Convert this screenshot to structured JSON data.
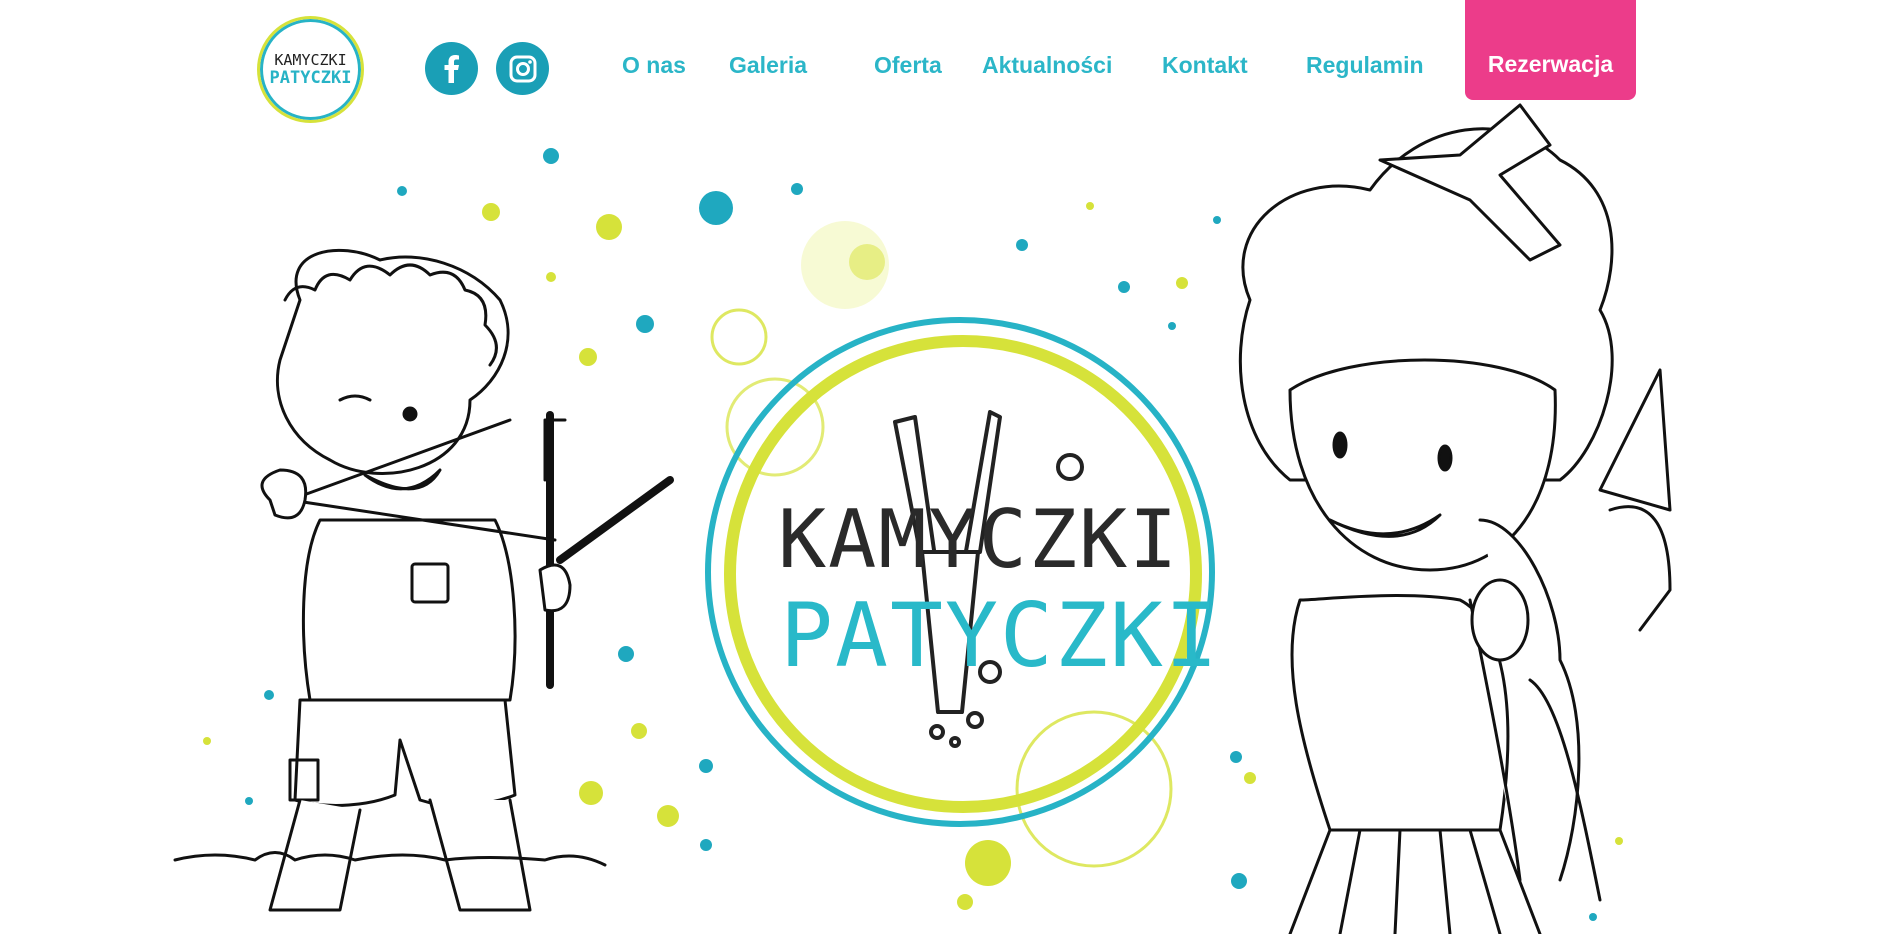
{
  "brand": {
    "logo_line1": "KAMYCZKI",
    "logo_line2": "PATYCZKI",
    "hero_line1": "KAMYCZKI",
    "hero_line2": "PATYCZKI"
  },
  "social": {
    "facebook_label": "f",
    "instagram_icon": "instagram-icon"
  },
  "nav": {
    "items": [
      "O nas",
      "Galeria",
      "Oferta",
      "Aktualności",
      "Kontakt",
      "Regulamin"
    ],
    "cta": "Rezerwacja"
  },
  "colors": {
    "teal": "#27b3c6",
    "lime": "#d6e23a",
    "pink": "#ec3c8a",
    "ink": "#222222"
  }
}
